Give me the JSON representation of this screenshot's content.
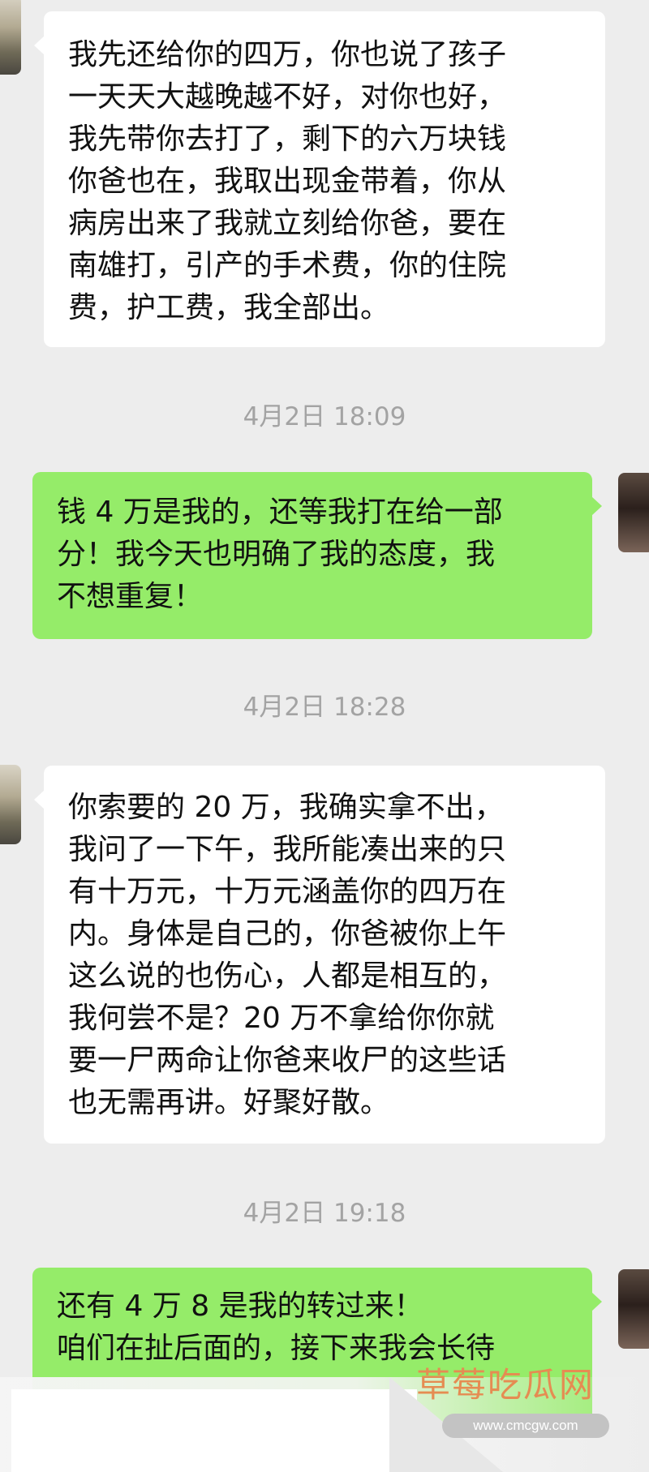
{
  "chat": {
    "messages": [
      {
        "direction": "received",
        "text": "我先还给你的四万，你也说了孩子\n一天天大越晚越不好，对你也好，\n我先带你去打了，剩下的六万块钱\n你爸也在，我取出现金带着，你从\n病房出来了我就立刻给你爸，要在\n南雄打，引产的手术费，你的住院\n费，护工费，我全部出。"
      },
      {
        "timestamp": "4月2日 18:09"
      },
      {
        "direction": "sent",
        "text": "钱 4 万是我的，还等我打在给一部\n分！我今天也明确了我的态度，我\n不想重复！"
      },
      {
        "timestamp": "4月2日 18:28"
      },
      {
        "direction": "received",
        "text": "你索要的 20 万，我确实拿不出，\n我问了一下午，我所能凑出来的只\n有十万元，十万元涵盖你的四万在\n内。身体是自己的，你爸被你上午\n这么说的也伤心，人都是相互的，\n我何尝不是？20 万不拿给你你就\n要一尸两命让你爸来收尸的这些话\n也无需再讲。好聚好散。"
      },
      {
        "timestamp": "4月2日 19:18"
      },
      {
        "direction": "sent",
        "text": "还有 4 万 8 是我的转过来！\n咱们在扯后面的，接下来我会长待"
      }
    ]
  },
  "watermark": {
    "title": "草莓吃瓜网",
    "url": "www.cmcgw.com"
  },
  "colors": {
    "background": "#ededed",
    "received_bubble": "#ffffff",
    "sent_bubble": "#95ec69",
    "timestamp_text": "#a3a3a3",
    "watermark_title": "#e58c52"
  }
}
